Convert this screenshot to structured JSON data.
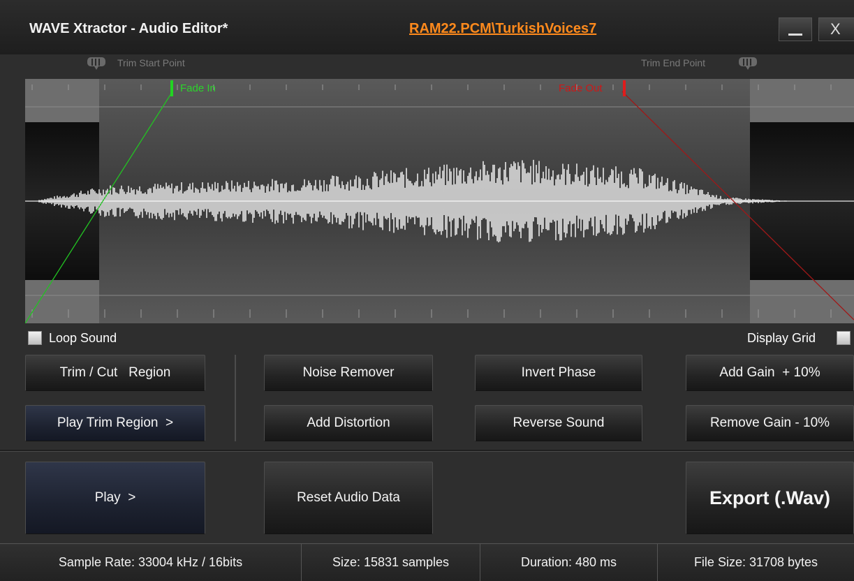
{
  "window": {
    "title": "WAVE Xtractor - Audio Editor*",
    "file_path": "RAM22.PCM\\TurkishVoices7",
    "close_glyph": "X"
  },
  "trim": {
    "start_label": "Trim Start Point",
    "end_label": "Trim End Point"
  },
  "fade": {
    "in_label": "Fade In",
    "out_label": "Fade Out",
    "in_color": "#2cd42c",
    "out_color": "#cc1818"
  },
  "options": {
    "loop_label": "Loop Sound",
    "grid_label": "Display Grid"
  },
  "buttons": {
    "trim_cut": "Trim / Cut   Region",
    "play_trim": "Play Trim Region  >",
    "noise_remover": "Noise Remover",
    "add_distortion": "Add Distortion",
    "invert_phase": "Invert Phase",
    "reverse_sound": "Reverse Sound",
    "add_gain": "Add Gain  + 10%",
    "remove_gain": "Remove Gain - 10%",
    "play": "Play  >",
    "reset": "Reset Audio Data",
    "export": "Export (.Wav)"
  },
  "status": {
    "sample_rate": "Sample Rate: 33004 kHz / 16bits",
    "size": "Size: 15831 samples",
    "duration": "Duration: 480 ms",
    "file_size": "File Size: 31708 bytes"
  },
  "colors": {
    "link": "#ff8a1c",
    "waveform": "#ffffff",
    "accent_button": "#1d2230"
  }
}
